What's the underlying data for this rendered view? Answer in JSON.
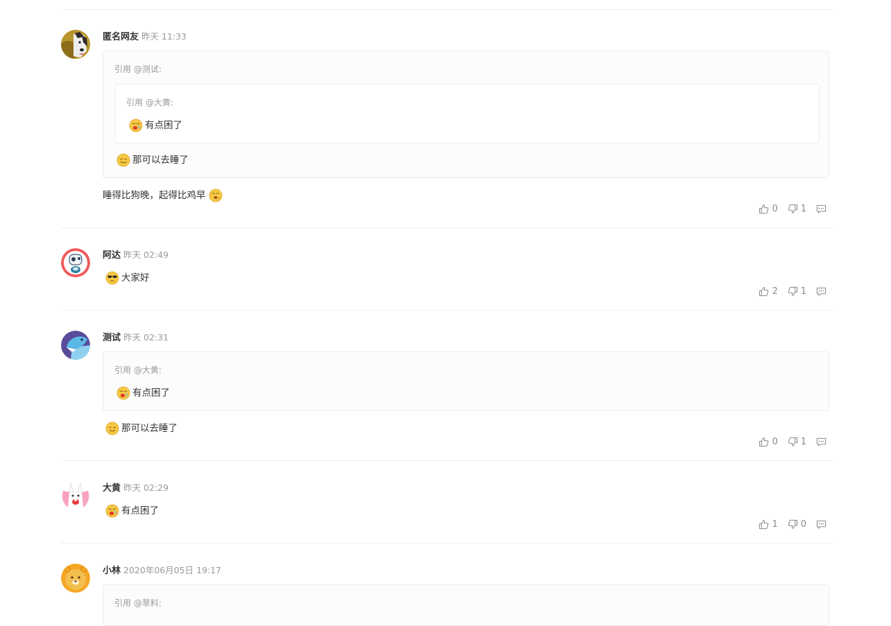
{
  "quote_prefix": "引用",
  "comments": [
    {
      "author": "匿名网友",
      "time": "昨天 11:33",
      "quote": {
        "label": "@测试:",
        "inner": {
          "label": "@大黄:",
          "text": "有点困了"
        },
        "text": "那可以去睡了"
      },
      "text": "睡得比狗晚，起得比鸡早",
      "likes": "0",
      "dislikes": "1"
    },
    {
      "author": "阿达",
      "time": "昨天 02:49",
      "text": "大家好",
      "likes": "2",
      "dislikes": "1"
    },
    {
      "author": "测试",
      "time": "昨天 02:31",
      "quote": {
        "label": "@大黄:",
        "text": "有点困了"
      },
      "text": "那可以去睡了",
      "likes": "0",
      "dislikes": "1"
    },
    {
      "author": "大黄",
      "time": "昨天 02:29",
      "text": "有点困了",
      "likes": "1",
      "dislikes": "0"
    },
    {
      "author": "小林",
      "time": "2020年06月05日 19:17",
      "quote": {
        "label": "@草料:"
      }
    }
  ],
  "icons": [
    "like-icon",
    "dislike-icon",
    "reply-icon"
  ],
  "colors": {
    "divider": "#efefef",
    "quote_bg": "#fcfcfc",
    "muted": "#999999",
    "emoji": "#f7c844"
  }
}
